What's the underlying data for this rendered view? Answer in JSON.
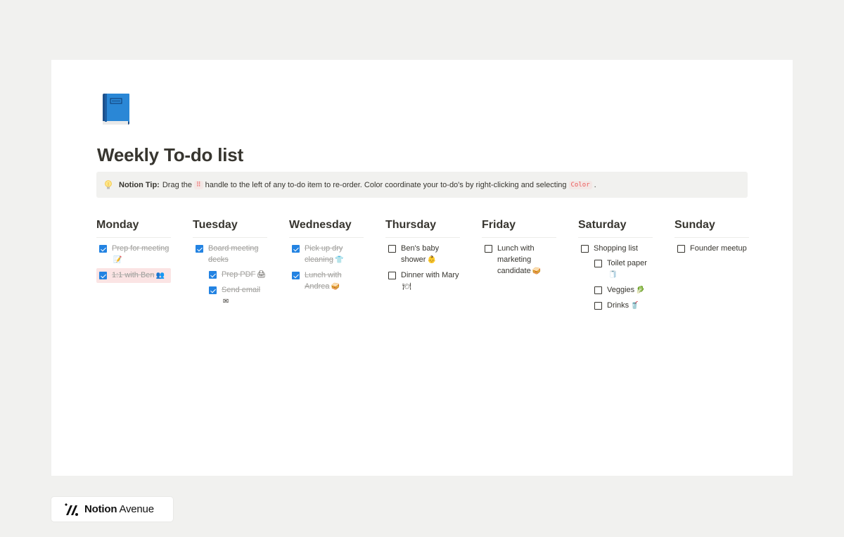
{
  "page": {
    "title": "Weekly To-do list",
    "icon": "blue-book-icon"
  },
  "callout": {
    "icon": "light-bulb-icon",
    "label": "Notion Tip:",
    "text_before": "Drag the",
    "handle_code": "⠿",
    "text_middle": "handle to the left of any to-do item to re-order. Color coordinate your to-do's by right-clicking and selecting",
    "color_code": "Color",
    "text_after": "."
  },
  "days": [
    {
      "name": "Monday",
      "items": [
        {
          "text": "Prep for meeting",
          "emoji": "📝",
          "checked": true,
          "sub": false
        },
        {
          "text": "1:1 with Ben",
          "emoji": "👥",
          "checked": true,
          "sub": false,
          "highlight": "#fbe4e4"
        }
      ]
    },
    {
      "name": "Tuesday",
      "items": [
        {
          "text": "Board meeting decks",
          "emoji": "",
          "checked": true,
          "sub": false
        },
        {
          "text": "Prep PDF",
          "emoji": "🖨",
          "checked": true,
          "sub": true
        },
        {
          "text": "Send email",
          "emoji": "✉",
          "checked": true,
          "sub": true
        }
      ]
    },
    {
      "name": "Wednesday",
      "items": [
        {
          "text": "Pick up dry cleaning",
          "emoji": "👕",
          "checked": true,
          "sub": false
        },
        {
          "text": "Lunch with Andrea",
          "emoji": "🥪",
          "checked": true,
          "sub": false
        }
      ]
    },
    {
      "name": "Thursday",
      "items": [
        {
          "text": "Ben's baby shower",
          "emoji": "👶",
          "checked": false,
          "sub": false
        },
        {
          "text": "Dinner with Mary",
          "emoji": "🍽",
          "checked": false,
          "sub": false
        }
      ]
    },
    {
      "name": "Friday",
      "items": [
        {
          "text": "Lunch with marketing candidate",
          "emoji": "🥪",
          "checked": false,
          "sub": false
        }
      ]
    },
    {
      "name": "Saturday",
      "items": [
        {
          "text": "Shopping list",
          "emoji": "",
          "checked": false,
          "sub": false
        },
        {
          "text": "Toilet paper",
          "emoji": "🧻",
          "checked": false,
          "sub": true
        },
        {
          "text": "Veggies",
          "emoji": "🥬",
          "checked": false,
          "sub": true
        },
        {
          "text": "Drinks",
          "emoji": "🥤",
          "checked": false,
          "sub": true
        }
      ]
    },
    {
      "name": "Sunday",
      "items": [
        {
          "text": "Founder meetup",
          "emoji": "",
          "checked": false,
          "sub": false
        }
      ]
    }
  ],
  "footer": {
    "brand_bold": "Notion",
    "brand_regular": "Avenue",
    "icon": "notion-avenue-logo-icon"
  },
  "colors": {
    "checkbox_checked": "#2383e2",
    "highlight_red": "#fbe4e4",
    "code_red": "#eb5757"
  }
}
